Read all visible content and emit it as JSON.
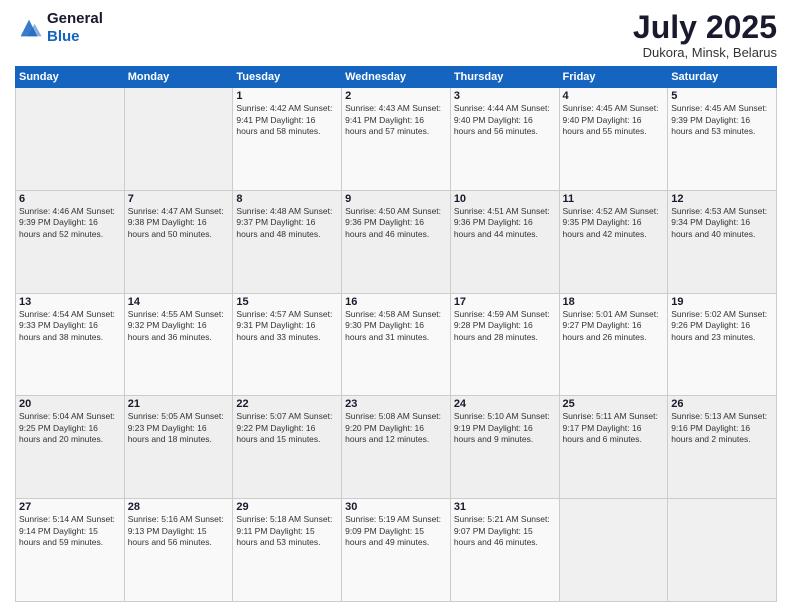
{
  "logo": {
    "line1": "General",
    "line2": "Blue"
  },
  "title": "July 2025",
  "subtitle": "Dukora, Minsk, Belarus",
  "weekdays": [
    "Sunday",
    "Monday",
    "Tuesday",
    "Wednesday",
    "Thursday",
    "Friday",
    "Saturday"
  ],
  "weeks": [
    [
      {
        "num": "",
        "info": ""
      },
      {
        "num": "",
        "info": ""
      },
      {
        "num": "1",
        "info": "Sunrise: 4:42 AM\nSunset: 9:41 PM\nDaylight: 16 hours\nand 58 minutes."
      },
      {
        "num": "2",
        "info": "Sunrise: 4:43 AM\nSunset: 9:41 PM\nDaylight: 16 hours\nand 57 minutes."
      },
      {
        "num": "3",
        "info": "Sunrise: 4:44 AM\nSunset: 9:40 PM\nDaylight: 16 hours\nand 56 minutes."
      },
      {
        "num": "4",
        "info": "Sunrise: 4:45 AM\nSunset: 9:40 PM\nDaylight: 16 hours\nand 55 minutes."
      },
      {
        "num": "5",
        "info": "Sunrise: 4:45 AM\nSunset: 9:39 PM\nDaylight: 16 hours\nand 53 minutes."
      }
    ],
    [
      {
        "num": "6",
        "info": "Sunrise: 4:46 AM\nSunset: 9:39 PM\nDaylight: 16 hours\nand 52 minutes."
      },
      {
        "num": "7",
        "info": "Sunrise: 4:47 AM\nSunset: 9:38 PM\nDaylight: 16 hours\nand 50 minutes."
      },
      {
        "num": "8",
        "info": "Sunrise: 4:48 AM\nSunset: 9:37 PM\nDaylight: 16 hours\nand 48 minutes."
      },
      {
        "num": "9",
        "info": "Sunrise: 4:50 AM\nSunset: 9:36 PM\nDaylight: 16 hours\nand 46 minutes."
      },
      {
        "num": "10",
        "info": "Sunrise: 4:51 AM\nSunset: 9:36 PM\nDaylight: 16 hours\nand 44 minutes."
      },
      {
        "num": "11",
        "info": "Sunrise: 4:52 AM\nSunset: 9:35 PM\nDaylight: 16 hours\nand 42 minutes."
      },
      {
        "num": "12",
        "info": "Sunrise: 4:53 AM\nSunset: 9:34 PM\nDaylight: 16 hours\nand 40 minutes."
      }
    ],
    [
      {
        "num": "13",
        "info": "Sunrise: 4:54 AM\nSunset: 9:33 PM\nDaylight: 16 hours\nand 38 minutes."
      },
      {
        "num": "14",
        "info": "Sunrise: 4:55 AM\nSunset: 9:32 PM\nDaylight: 16 hours\nand 36 minutes."
      },
      {
        "num": "15",
        "info": "Sunrise: 4:57 AM\nSunset: 9:31 PM\nDaylight: 16 hours\nand 33 minutes."
      },
      {
        "num": "16",
        "info": "Sunrise: 4:58 AM\nSunset: 9:30 PM\nDaylight: 16 hours\nand 31 minutes."
      },
      {
        "num": "17",
        "info": "Sunrise: 4:59 AM\nSunset: 9:28 PM\nDaylight: 16 hours\nand 28 minutes."
      },
      {
        "num": "18",
        "info": "Sunrise: 5:01 AM\nSunset: 9:27 PM\nDaylight: 16 hours\nand 26 minutes."
      },
      {
        "num": "19",
        "info": "Sunrise: 5:02 AM\nSunset: 9:26 PM\nDaylight: 16 hours\nand 23 minutes."
      }
    ],
    [
      {
        "num": "20",
        "info": "Sunrise: 5:04 AM\nSunset: 9:25 PM\nDaylight: 16 hours\nand 20 minutes."
      },
      {
        "num": "21",
        "info": "Sunrise: 5:05 AM\nSunset: 9:23 PM\nDaylight: 16 hours\nand 18 minutes."
      },
      {
        "num": "22",
        "info": "Sunrise: 5:07 AM\nSunset: 9:22 PM\nDaylight: 16 hours\nand 15 minutes."
      },
      {
        "num": "23",
        "info": "Sunrise: 5:08 AM\nSunset: 9:20 PM\nDaylight: 16 hours\nand 12 minutes."
      },
      {
        "num": "24",
        "info": "Sunrise: 5:10 AM\nSunset: 9:19 PM\nDaylight: 16 hours\nand 9 minutes."
      },
      {
        "num": "25",
        "info": "Sunrise: 5:11 AM\nSunset: 9:17 PM\nDaylight: 16 hours\nand 6 minutes."
      },
      {
        "num": "26",
        "info": "Sunrise: 5:13 AM\nSunset: 9:16 PM\nDaylight: 16 hours\nand 2 minutes."
      }
    ],
    [
      {
        "num": "27",
        "info": "Sunrise: 5:14 AM\nSunset: 9:14 PM\nDaylight: 15 hours\nand 59 minutes."
      },
      {
        "num": "28",
        "info": "Sunrise: 5:16 AM\nSunset: 9:13 PM\nDaylight: 15 hours\nand 56 minutes."
      },
      {
        "num": "29",
        "info": "Sunrise: 5:18 AM\nSunset: 9:11 PM\nDaylight: 15 hours\nand 53 minutes."
      },
      {
        "num": "30",
        "info": "Sunrise: 5:19 AM\nSunset: 9:09 PM\nDaylight: 15 hours\nand 49 minutes."
      },
      {
        "num": "31",
        "info": "Sunrise: 5:21 AM\nSunset: 9:07 PM\nDaylight: 15 hours\nand 46 minutes."
      },
      {
        "num": "",
        "info": ""
      },
      {
        "num": "",
        "info": ""
      }
    ]
  ]
}
